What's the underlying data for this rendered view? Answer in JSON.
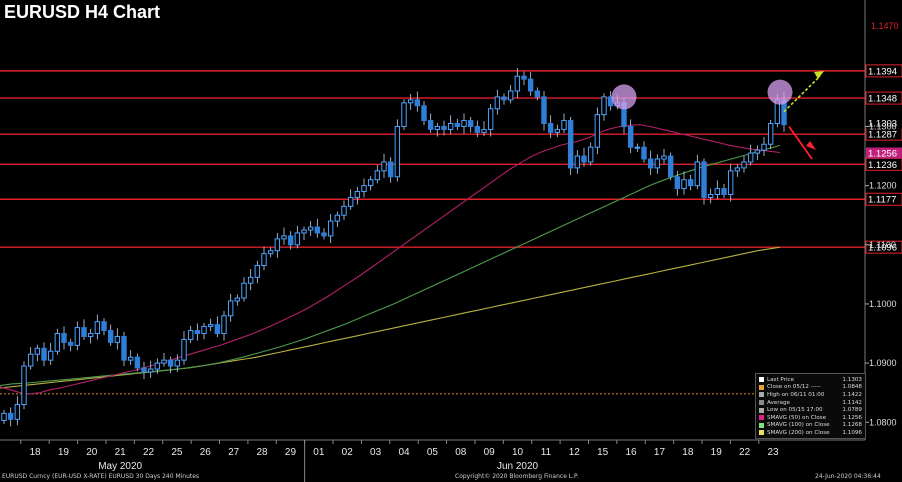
{
  "title": "EURUSD H4 Chart",
  "footer": {
    "left": "EURUSD Curncy (EUR-USD X-RATE) EURUSD 30 Days 240 Minutes",
    "center": "Copyright© 2020 Bloomberg Finance L.P.",
    "right": "24-Jun-2020 04:36:44"
  },
  "legend": [
    {
      "label": "Last Price",
      "value": "1.1303",
      "color": "#ffffff"
    },
    {
      "label": "Close on 05/12 -----",
      "value": "1.0848",
      "color": "#f0a030"
    },
    {
      "label": "High on 06/11 01:00",
      "value": "1.1422",
      "color": "#aaaaaa"
    },
    {
      "label": "Average",
      "value": "1.1142",
      "color": "#888888"
    },
    {
      "label": "Low on 05/15 17:00",
      "value": "1.0789",
      "color": "#aaaaaa"
    },
    {
      "label": "SMAVG (50)  on Close",
      "value": "1.1256",
      "color": "#e01e8c"
    },
    {
      "label": "SMAVG (100)  on Close",
      "value": "1.1268",
      "color": "#7ee07e"
    },
    {
      "label": "SMAVG (200)  on Close",
      "value": "1.1096",
      "color": "#e8e060"
    }
  ],
  "chart_data": {
    "type": "candlestick",
    "instrument": "EURUSD",
    "timeframe": "H4",
    "ylim": [
      1.077,
      1.148
    ],
    "y_ticks": [
      "1.0800",
      "1.0900",
      "1.1000",
      "1.1100",
      "1.1200",
      "1.1300"
    ],
    "x_ticks": [
      "18",
      "19",
      "20",
      "21",
      "22",
      "25",
      "26",
      "27",
      "28",
      "29",
      "01",
      "02",
      "03",
      "04",
      "05",
      "08",
      "09",
      "10",
      "11",
      "12",
      "15",
      "16",
      "17",
      "18",
      "19",
      "22",
      "23"
    ],
    "month_labels": [
      {
        "label": "May 2020",
        "at_tick": "21"
      },
      {
        "label": "Jun 2020",
        "at_tick": "10"
      }
    ],
    "horizontal_levels": [
      {
        "value": 1.1394,
        "label": "1.1394"
      },
      {
        "value": 1.1348,
        "label": "1.1348"
      },
      {
        "value": 1.1287,
        "label": "1.1287"
      },
      {
        "value": 1.1236,
        "label": "1.1236"
      },
      {
        "value": 1.1177,
        "label": "1.1177"
      },
      {
        "value": 1.1096,
        "label": "1.1096"
      }
    ],
    "top_level_label": "1.1470",
    "last_price": {
      "value": 1.1303,
      "label": "1.1303"
    },
    "sma50_label": {
      "value": 1.1256,
      "label": "1.1256"
    },
    "close_dotted_level": 1.0848,
    "close": [
      1.0815,
      1.0805,
      1.083,
      1.0895,
      1.0915,
      1.0925,
      1.0905,
      1.092,
      1.095,
      1.0935,
      1.093,
      1.096,
      1.0945,
      1.095,
      1.097,
      1.0955,
      1.0935,
      1.0945,
      1.0905,
      1.091,
      1.0892,
      1.0885,
      1.089,
      1.09,
      1.0905,
      1.0895,
      1.0905,
      1.094,
      1.0955,
      1.095,
      1.0962,
      1.0965,
      1.095,
      1.098,
      1.1005,
      1.101,
      1.1035,
      1.1045,
      1.1065,
      1.1085,
      1.109,
      1.111,
      1.1115,
      1.11,
      1.112,
      1.1125,
      1.113,
      1.112,
      1.1115,
      1.114,
      1.115,
      1.1165,
      1.118,
      1.119,
      1.12,
      1.121,
      1.1225,
      1.124,
      1.1215,
      1.13,
      1.134,
      1.1345,
      1.1335,
      1.131,
      1.1295,
      1.13,
      1.1295,
      1.1305,
      1.13,
      1.131,
      1.13,
      1.129,
      1.1295,
      1.133,
      1.135,
      1.1345,
      1.136,
      1.1385,
      1.138,
      1.136,
      1.135,
      1.1305,
      1.129,
      1.1295,
      1.131,
      1.123,
      1.125,
      1.124,
      1.1265,
      1.132,
      1.135,
      1.1335,
      1.134,
      1.13,
      1.1265,
      1.1265,
      1.1245,
      1.123,
      1.1245,
      1.125,
      1.1215,
      1.1195,
      1.121,
      1.12,
      1.124,
      1.118,
      1.1185,
      1.1195,
      1.1185,
      1.1225,
      1.123,
      1.124,
      1.1255,
      1.126,
      1.127,
      1.1305,
      1.1345,
      1.1303
    ],
    "sma50": [
      1.086,
      1.0855,
      1.085,
      1.0848,
      1.085,
      1.0855,
      1.0858,
      1.0862,
      1.0866,
      1.087,
      1.0874,
      1.0878,
      1.0882,
      1.0886,
      1.089,
      1.0895,
      1.09,
      1.0905,
      1.091,
      1.0915,
      1.092,
      1.0925,
      1.093,
      1.0936,
      1.0942,
      1.0948,
      1.0955,
      1.0962,
      1.097,
      1.0978,
      1.0986,
      1.0995,
      1.1005,
      1.1015,
      1.1026,
      1.1037,
      1.1048,
      1.106,
      1.1072,
      1.1084,
      1.1096,
      1.1108,
      1.112,
      1.1132,
      1.1144,
      1.1156,
      1.1168,
      1.118,
      1.1192,
      1.1204,
      1.1216,
      1.1228,
      1.1238,
      1.1248,
      1.1256,
      1.1262,
      1.1268,
      1.1272,
      1.1276,
      1.1282,
      1.129,
      1.1296,
      1.13,
      1.1302,
      1.1303,
      1.13,
      1.1296,
      1.1292,
      1.1288,
      1.1284,
      1.128,
      1.1276,
      1.1272,
      1.1268,
      1.1265,
      1.1262,
      1.126,
      1.1258,
      1.1256
    ],
    "sma100": [
      1.0862,
      1.0865,
      1.0866,
      1.0868,
      1.087,
      1.0872,
      1.0874,
      1.0876,
      1.0878,
      1.088,
      1.0882,
      1.0884,
      1.0886,
      1.0888,
      1.089,
      1.0893,
      1.0896,
      1.09,
      1.0905,
      1.091,
      1.0916,
      1.0922,
      1.0928,
      1.0935,
      1.0942,
      1.095,
      1.0958,
      1.0966,
      1.0975,
      1.0984,
      1.0993,
      1.1002,
      1.1012,
      1.1022,
      1.1032,
      1.1042,
      1.1052,
      1.1062,
      1.1072,
      1.1082,
      1.1092,
      1.1102,
      1.1112,
      1.1122,
      1.1132,
      1.1142,
      1.1152,
      1.1162,
      1.1172,
      1.1182,
      1.1192,
      1.1202,
      1.121,
      1.1218,
      1.1225,
      1.1232,
      1.1238,
      1.1244,
      1.125,
      1.1256,
      1.1262,
      1.1268
    ],
    "sma200": [
      1.0858,
      1.086,
      1.0862,
      1.0864,
      1.0866,
      1.0868,
      1.087,
      1.0872,
      1.0874,
      1.0876,
      1.0878,
      1.088,
      1.0882,
      1.0884,
      1.0886,
      1.0888,
      1.089,
      1.0892,
      1.0895,
      1.0898,
      1.0901,
      1.0904,
      1.0907,
      1.091,
      1.0914,
      1.0918,
      1.0922,
      1.0926,
      1.093,
      1.0934,
      1.0938,
      1.0942,
      1.0946,
      1.095,
      1.0954,
      1.0958,
      1.0962,
      1.0966,
      1.097,
      1.0974,
      1.0978,
      1.0982,
      1.0986,
      1.099,
      1.0994,
      1.0998,
      1.1002,
      1.1006,
      1.101,
      1.1014,
      1.1018,
      1.1022,
      1.1026,
      1.103,
      1.1034,
      1.1038,
      1.1042,
      1.1046,
      1.105,
      1.1054,
      1.1058,
      1.1062,
      1.1066,
      1.107,
      1.1074,
      1.1078,
      1.1082,
      1.1086,
      1.109,
      1.1093,
      1.1096
    ],
    "highlight_circles": [
      1.135,
      1.1358
    ],
    "arrows": [
      {
        "direction": "up",
        "color": "#c8e020"
      },
      {
        "direction": "down",
        "color": "#ff2030"
      }
    ],
    "colors": {
      "bull": "#4aa3ff",
      "bear": "#2f7fd8",
      "level_line": "#e0202a",
      "sma50": "#b0206a",
      "sma100": "#4c9a4c",
      "sma200": "#b8b040",
      "dotted": "#e08a20"
    },
    "grid": false
  }
}
